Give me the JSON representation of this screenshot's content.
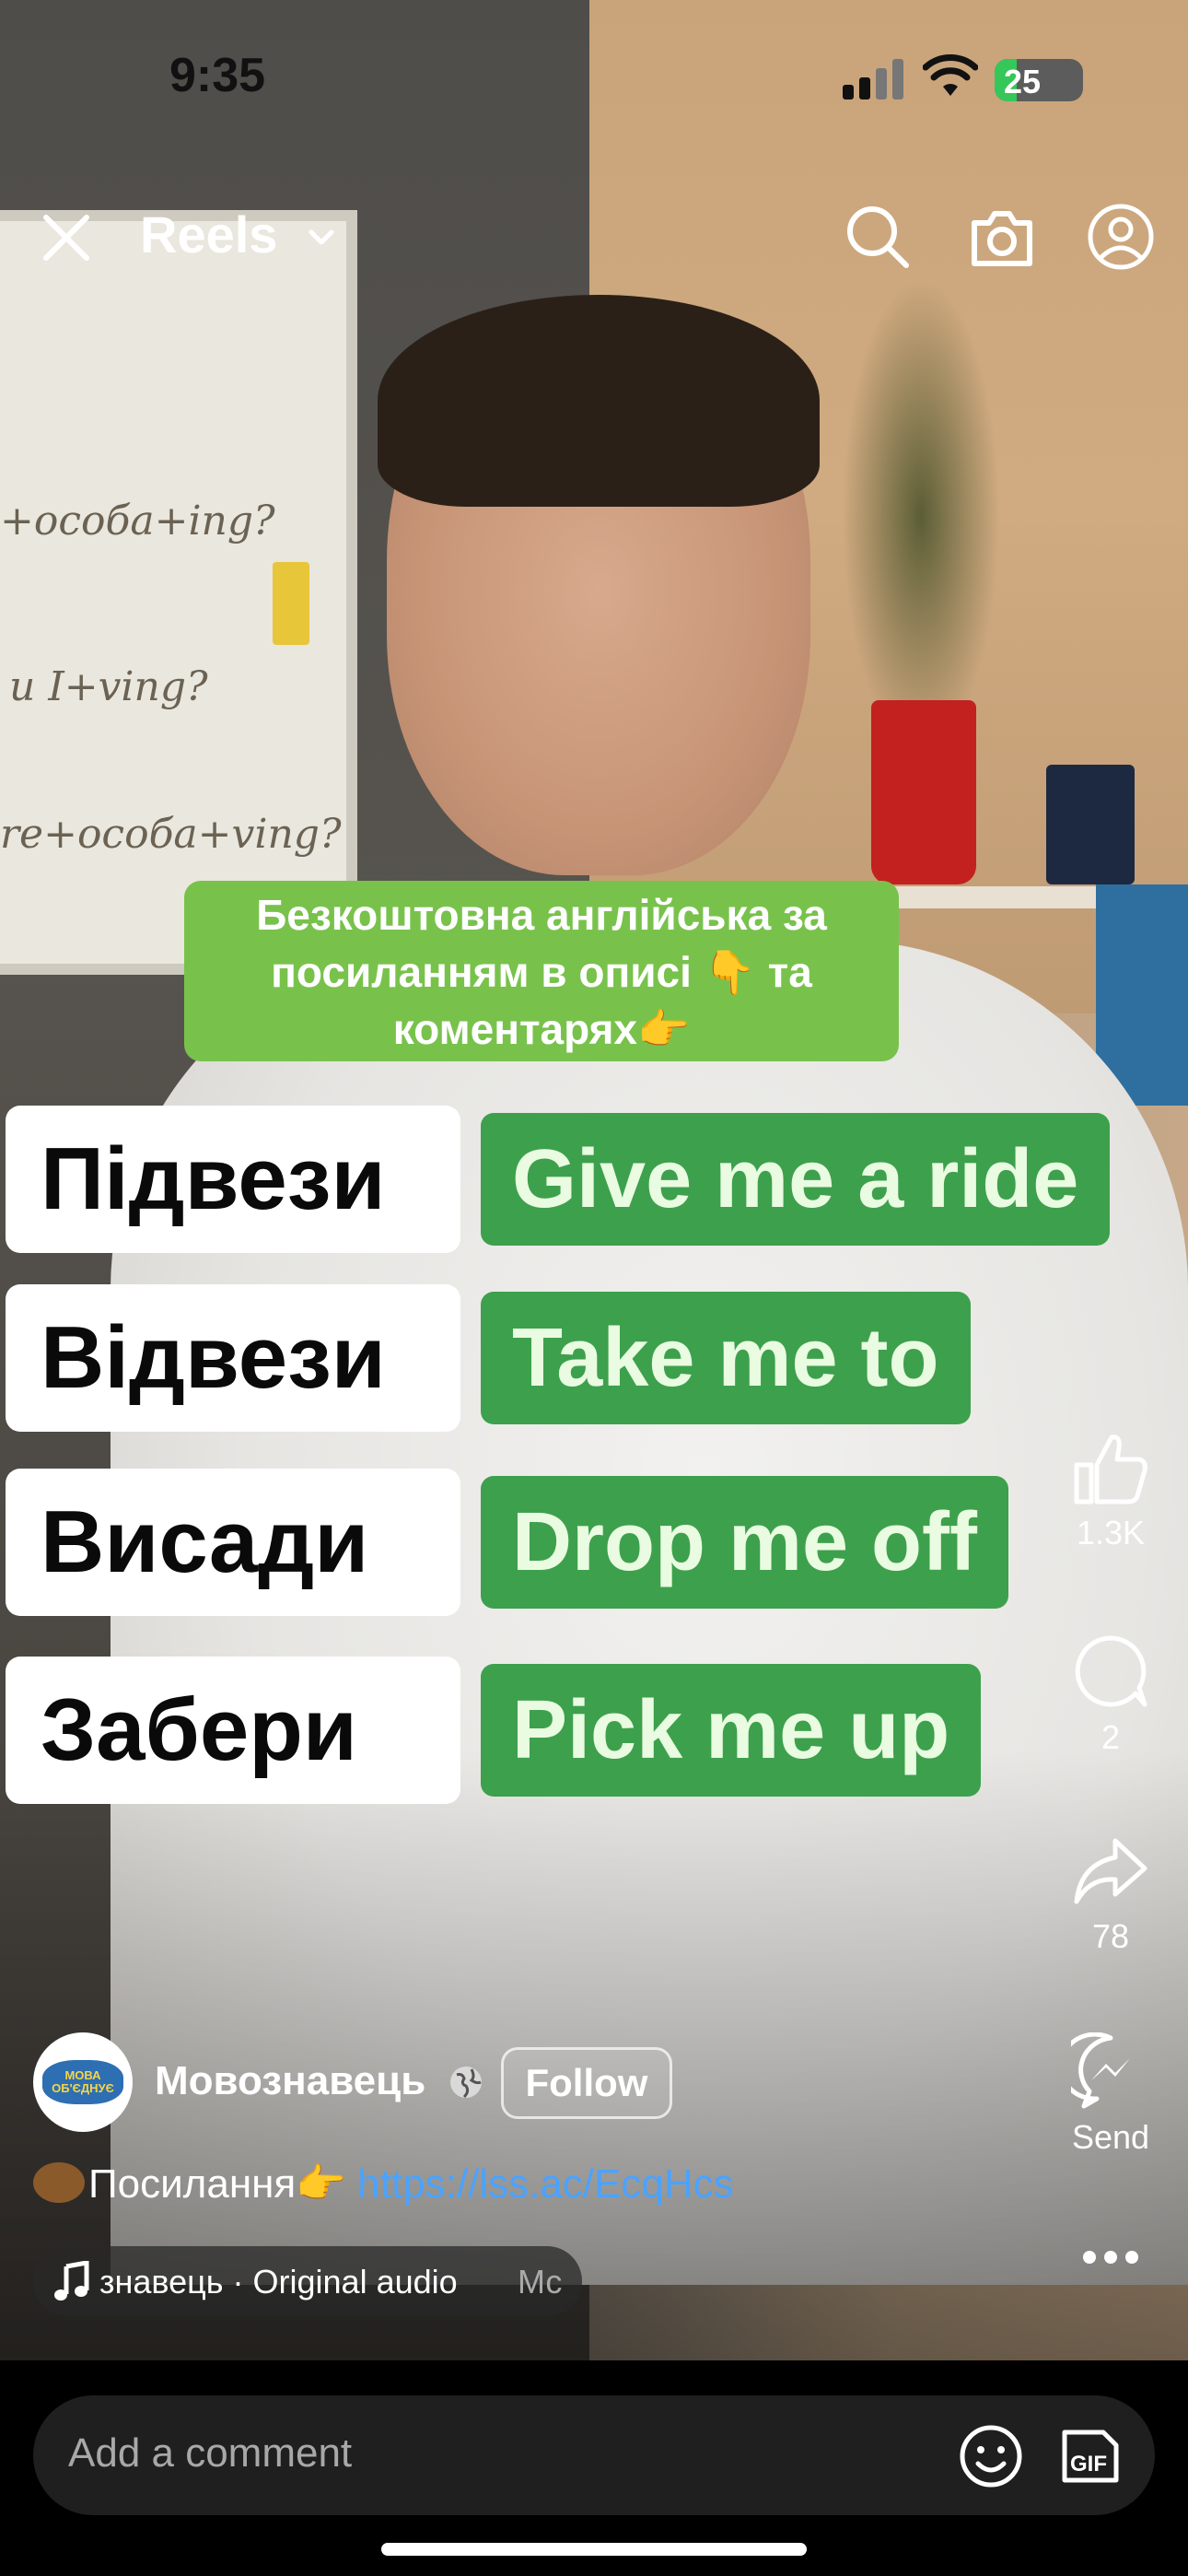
{
  "status_bar": {
    "time": "9:35",
    "battery": "25"
  },
  "top_bar": {
    "title": "Reels"
  },
  "overlay": {
    "promo_line1": "Безкоштовна англійська за",
    "promo_line2": "посиланням в описі 👇 та",
    "promo_line3": "коментарях👉",
    "pairs": [
      {
        "ua": "Підвези",
        "en": "Give me a ride"
      },
      {
        "ua": "Відвези",
        "en": "Take me to"
      },
      {
        "ua": "Висади",
        "en": "Drop me off"
      },
      {
        "ua": "Забери",
        "en": "Pick me up"
      }
    ]
  },
  "rail": {
    "likes": "1.3K",
    "comments": "2",
    "shares": "78",
    "send_label": "Send"
  },
  "author": {
    "name": "Мовознавець",
    "follow_label": "Follow",
    "avatar_text": "МОВА ОБ'ЄДНУЄ"
  },
  "caption": {
    "text": "Посилання👉",
    "link": "https://lss.ac/EcqHcs"
  },
  "audio": {
    "text": "знавець · Original audio",
    "text2": "Мс"
  },
  "comment": {
    "placeholder": "Add a comment"
  },
  "colors": {
    "caption_green": "#78c24c",
    "english_green": "#3da04d",
    "link_blue": "#4aa3ff"
  },
  "icons": [
    "close-icon",
    "chevron-down-icon",
    "search-icon",
    "camera-icon",
    "profile-icon",
    "heart-like-icon",
    "comment-icon",
    "share-icon",
    "messenger-icon",
    "more-icon",
    "globe-icon",
    "music-icon",
    "emoji-icon",
    "gif-icon"
  ]
}
